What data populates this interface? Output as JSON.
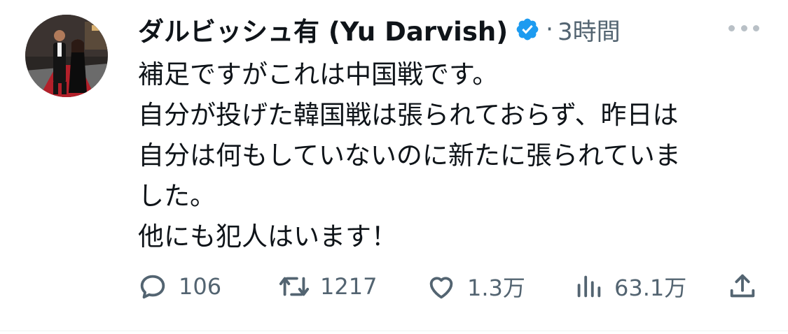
{
  "tweet": {
    "author": {
      "display_name": "ダルビッシュ有 (Yu Darvish)",
      "verified_icon": "verified-badge-icon",
      "avatar": "avatar-photo"
    },
    "separator": "·",
    "timestamp": "3時間",
    "more_icon": "more-options-icon",
    "lines": [
      "補足ですがこれは中国戦です。",
      "自分が投げた韓国戦は張られておらず、昨日は",
      "自分は何もしていないのに新たに張られていま",
      "した。",
      "他にも犯人はいます！"
    ]
  },
  "actions": {
    "reply": {
      "icon": "reply-icon",
      "count": "106"
    },
    "retweet": {
      "icon": "retweet-icon",
      "count": "1217"
    },
    "like": {
      "icon": "heart-icon",
      "count": "1.3万"
    },
    "views": {
      "icon": "views-icon",
      "count": "63.1万"
    },
    "share": {
      "icon": "share-icon"
    }
  },
  "colors": {
    "text": "#0f1419",
    "secondary": "#536471",
    "verified": "#1d9bf0",
    "divider": "#eff3f4"
  }
}
